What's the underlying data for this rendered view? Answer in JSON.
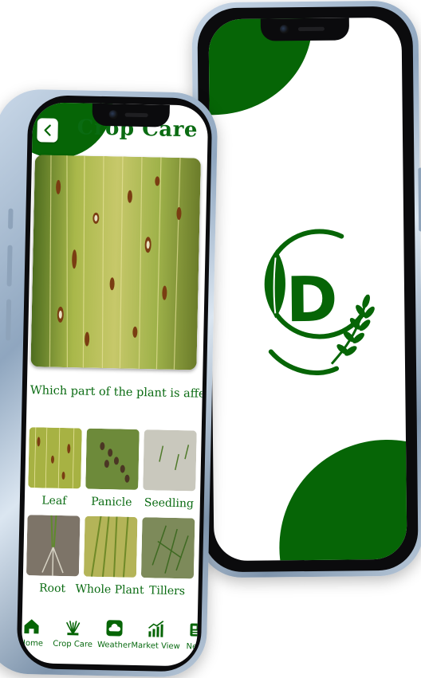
{
  "crop_care": {
    "title": "Crop Care",
    "question": "Which part of the plant is affected ?",
    "parts": [
      {
        "label": "Leaf"
      },
      {
        "label": "Panicle"
      },
      {
        "label": "Seedling"
      },
      {
        "label": "Root"
      },
      {
        "label": "Whole Plant"
      },
      {
        "label": "Tillers"
      }
    ]
  },
  "bottom_nav": {
    "items": [
      {
        "label": "Home",
        "icon": "home-icon"
      },
      {
        "label": "Crop Care",
        "icon": "crop-care-icon"
      },
      {
        "label": "Weather",
        "icon": "weather-icon"
      },
      {
        "label": "Market View",
        "icon": "market-view-icon"
      },
      {
        "label": "News",
        "icon": "news-icon"
      }
    ]
  },
  "splash": {
    "logo_letter": "D"
  },
  "colors": {
    "brand_green": "#066506",
    "text_green": "#0a6b12"
  }
}
